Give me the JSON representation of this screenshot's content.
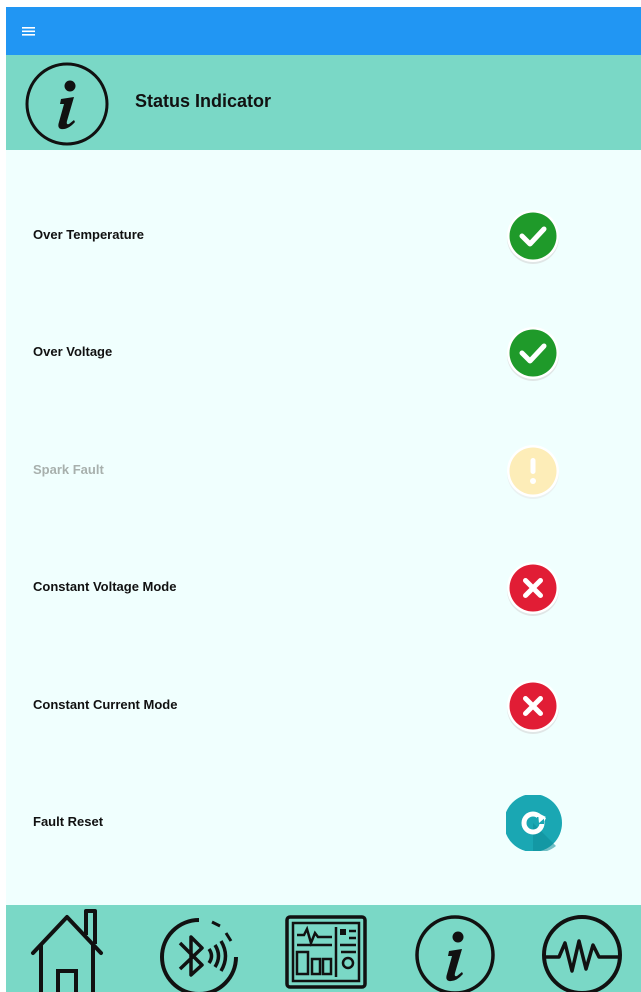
{
  "header": {
    "title": "Status Indicator",
    "icon": "info-icon"
  },
  "status_items": [
    {
      "label": "Over Temperature",
      "state": "ok",
      "icon": "check-icon",
      "enabled": true
    },
    {
      "label": "Over Voltage",
      "state": "ok",
      "icon": "check-icon",
      "enabled": true
    },
    {
      "label": "Spark Fault",
      "state": "warning",
      "icon": "exclamation-icon",
      "enabled": false
    },
    {
      "label": "Constant Voltage Mode",
      "state": "off",
      "icon": "cross-icon",
      "enabled": true
    },
    {
      "label": "Constant Current Mode",
      "state": "off",
      "icon": "cross-icon",
      "enabled": true
    },
    {
      "label": "Fault Reset",
      "state": "action",
      "icon": "refresh-icon",
      "enabled": true
    }
  ],
  "bottom_nav": {
    "items": [
      "home-icon",
      "bluetooth-icon",
      "dashboard-icon",
      "info-icon",
      "waveform-icon"
    ],
    "active": "info-icon"
  },
  "colors": {
    "appbar": "#2196f3",
    "header": "#7ad8c6",
    "background": "#f0fffe",
    "ok": "#1f9a2a",
    "warning": "#fdedb8",
    "off": "#e11d35",
    "action": "#1aa7b3"
  }
}
